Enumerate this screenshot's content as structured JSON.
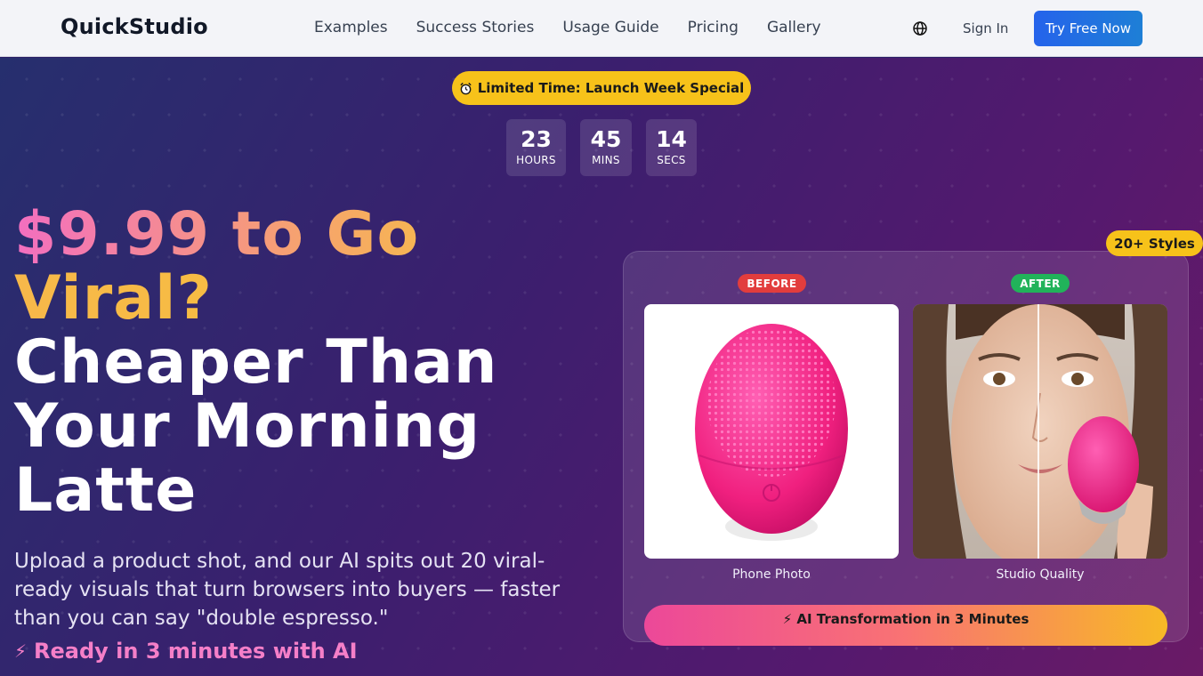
{
  "nav": {
    "logo": "QuickStudio",
    "links": [
      "Examples",
      "Success Stories",
      "Usage Guide",
      "Pricing",
      "Gallery"
    ],
    "language_icon": "globe-icon",
    "signin_label": "Sign In",
    "cta_label": "Try Free Now"
  },
  "hero": {
    "promo_badge": "Limited Time: Launch Week Special",
    "promo_icon": "alarm-clock-icon",
    "countdown": [
      {
        "value": "23",
        "label": "HOURS"
      },
      {
        "value": "45",
        "label": "MINS"
      },
      {
        "value": "14",
        "label": "SECS"
      }
    ],
    "headline_part1": "$9.99 to Go",
    "headline_part2": "Viral?",
    "headline_part3": "Cheaper Than",
    "headline_part4": "Your Morning",
    "headline_part5": "Latte",
    "subtitle": "Upload a product shot, and our AI spits out 20 viral-ready visuals that turn browsers into buyers — faster than you can say \"double espresso.\"",
    "ready_icon": "lightning-icon",
    "ready_text": "Ready in 3 minutes with AI"
  },
  "showcase": {
    "styles_badge": "20+ Styles",
    "before_tag": "BEFORE",
    "after_tag": "AFTER",
    "before_caption": "Phone Photo",
    "after_caption": "Studio Quality",
    "cta_label": "⚡ AI Transformation in 3 Minutes"
  },
  "colors": {
    "brand_blue": "#2563eb",
    "promo_yellow": "#f7c21a",
    "before_red": "#e23d3d",
    "after_green": "#21b35a",
    "accent_pink": "#f57fc8"
  }
}
